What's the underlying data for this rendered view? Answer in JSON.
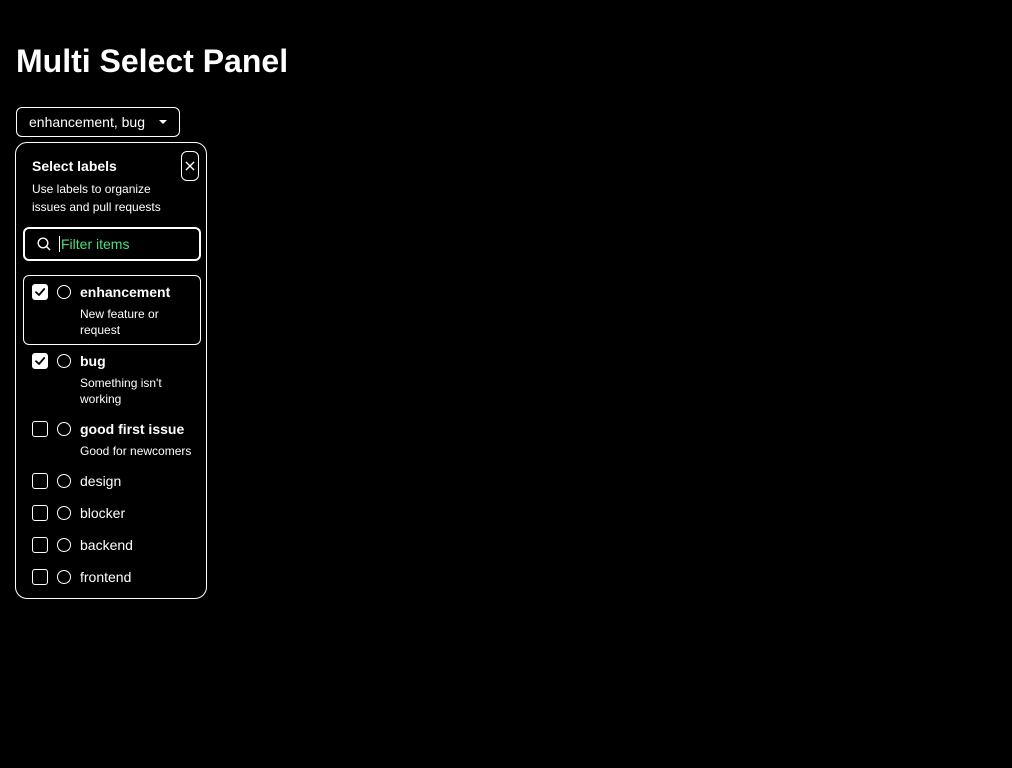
{
  "page": {
    "title": "Multi Select Panel"
  },
  "trigger": {
    "label": "enhancement, bug",
    "icon": "triangle-down-icon"
  },
  "panel": {
    "title": "Select labels",
    "description": "Use labels to organize issues and pull requests",
    "close_icon": "close-icon",
    "filter": {
      "placeholder": "Filter items",
      "value": "",
      "icon": "search-icon"
    },
    "options": [
      {
        "label": "enhancement",
        "description": "New feature or request",
        "checked": true,
        "focused": true
      },
      {
        "label": "bug",
        "description": "Something isn't working",
        "checked": true,
        "focused": false
      },
      {
        "label": "good first issue",
        "description": "Good for newcomers",
        "checked": false,
        "focused": false
      },
      {
        "label": "design",
        "description": "",
        "checked": false,
        "focused": false
      },
      {
        "label": "blocker",
        "description": "",
        "checked": false,
        "focused": false
      },
      {
        "label": "backend",
        "description": "",
        "checked": false,
        "focused": false
      },
      {
        "label": "frontend",
        "description": "",
        "checked": false,
        "focused": false
      }
    ]
  },
  "colors": {
    "background": "#000000",
    "foreground": "#ffffff",
    "placeholder": "#4ade80"
  }
}
